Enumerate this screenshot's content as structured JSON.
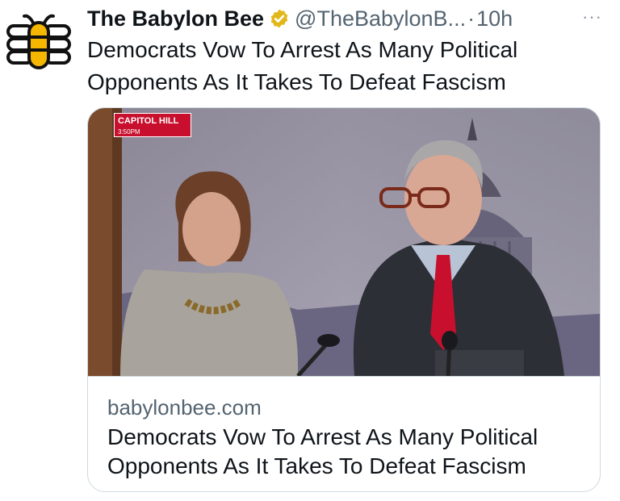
{
  "account": {
    "display_name": "The Babylon Bee",
    "handle": "@TheBabylonB...",
    "separator": "·",
    "time_ago": "10h",
    "more_glyph": "···"
  },
  "tweet": {
    "text": "Democrats Vow To Arrest As Many Political Opponents As It Takes To Defeat Fascism"
  },
  "card": {
    "chyron_location": "CAPITOL HILL",
    "chyron_time": "3:50PM",
    "domain": "babylonbee.com",
    "title": "Democrats Vow To Arrest As Many Political Opponents As It Takes To Defeat Fascism"
  },
  "colors": {
    "brand_yellow": "#f5b700",
    "verified_gold": "#e2b719",
    "secondary_text": "#536471",
    "border": "#cfd9de",
    "tie_red": "#c8102e"
  },
  "icons": {
    "avatar": "babylon-bee-logo-icon",
    "verified": "verified-badge-icon",
    "more": "more-options-icon"
  }
}
